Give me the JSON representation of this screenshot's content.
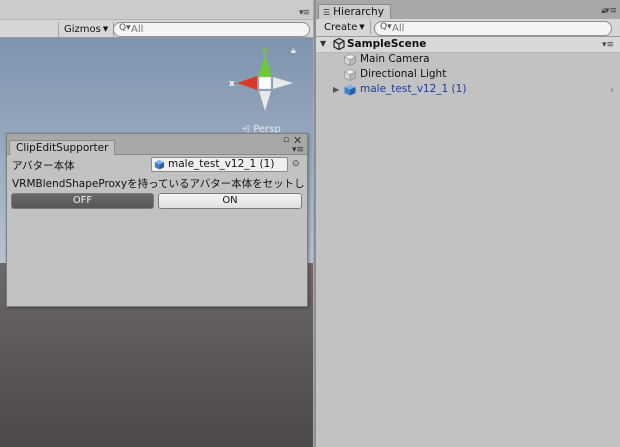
{
  "scene_view": {
    "gizmos_label": "Gizmos",
    "search_placeholder": "All",
    "projection_label": "Persp",
    "axis_x": "x",
    "axis_y": "y"
  },
  "clip_window": {
    "tab_label": "ClipEditSupporter",
    "avatar_label": "アバター本体",
    "avatar_value": "male_test_v12_1 (1)",
    "message": "VRMBlendShapeProxyを持っているアバター本体をセットし",
    "off_label": "OFF",
    "on_label": "ON"
  },
  "hierarchy": {
    "tab_label": "Hierarchy",
    "create_label": "Create",
    "search_placeholder": "All",
    "scene_name": "SampleScene",
    "items": [
      {
        "label": "Main Camera",
        "icon": "gameobject-icon"
      },
      {
        "label": "Directional Light",
        "icon": "gameobject-icon"
      },
      {
        "label": "male_test_v12_1 (1)",
        "icon": "prefab-cube-icon"
      }
    ]
  },
  "colors": {
    "prefab_text": "#1c3a9e",
    "gizmo_x": "#d83a2a",
    "gizmo_y": "#6fc83a",
    "off_button": "#5f5f5f"
  }
}
